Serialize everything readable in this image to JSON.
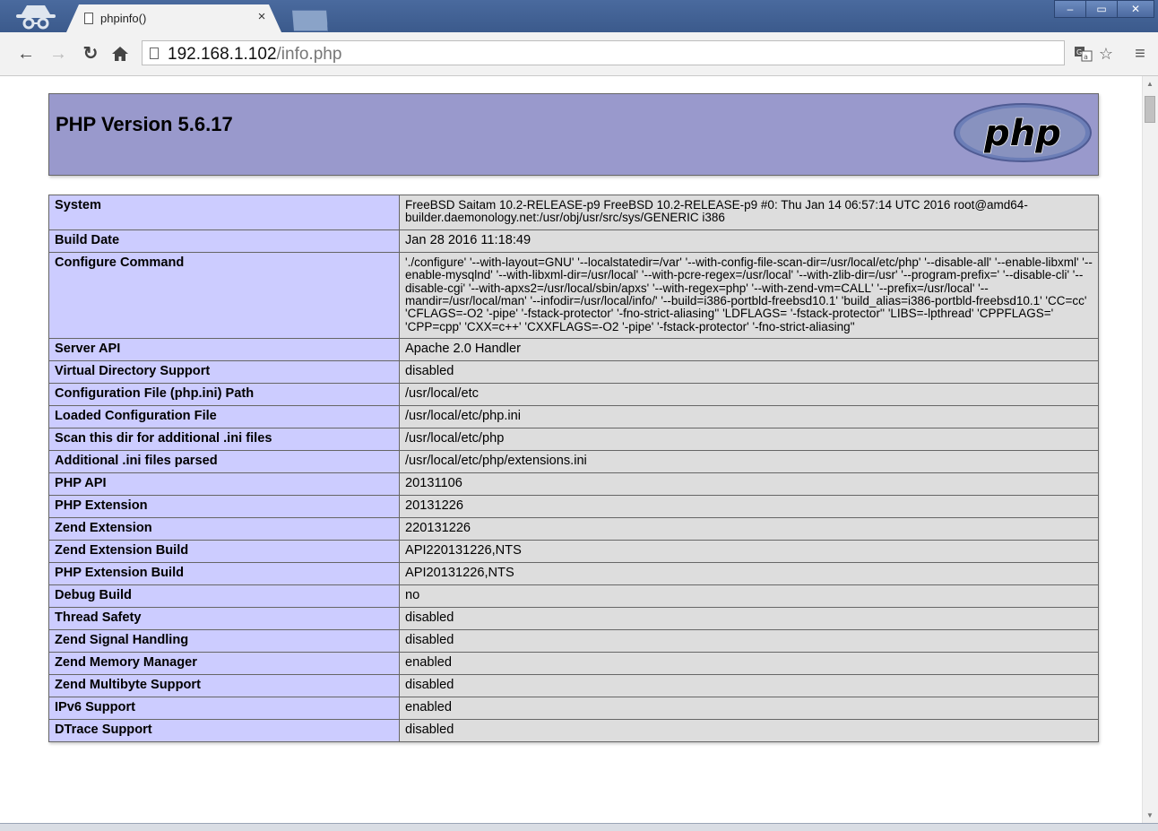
{
  "browser": {
    "tab_title": "phpinfo()",
    "tab_close": "×",
    "url_host": "192.168.1.102",
    "url_path": "/info.php",
    "window_controls": [
      "–",
      "▭",
      "✕"
    ]
  },
  "page": {
    "version_title": "PHP Version 5.6.17",
    "logo_text": "php",
    "rows": [
      {
        "key": "System",
        "value": "FreeBSD Saitam 10.2-RELEASE-p9 FreeBSD 10.2-RELEASE-p9 #0: Thu Jan 14 06:57:14 UTC 2016 root@amd64-builder.daemonology.net:/usr/obj/usr/src/sys/GENERIC i386"
      },
      {
        "key": "Build Date",
        "value": "Jan 28 2016 11:18:49"
      },
      {
        "key": "Configure Command",
        "value": "'./configure' '--with-layout=GNU' '--localstatedir=/var' '--with-config-file-scan-dir=/usr/local/etc/php' '--disable-all' '--enable-libxml' '--enable-mysqlnd' '--with-libxml-dir=/usr/local' '--with-pcre-regex=/usr/local' '--with-zlib-dir=/usr' '--program-prefix=' '--disable-cli' '--disable-cgi' '--with-apxs2=/usr/local/sbin/apxs' '--with-regex=php' '--with-zend-vm=CALL' '--prefix=/usr/local' '--mandir=/usr/local/man' '--infodir=/usr/local/info/' '--build=i386-portbld-freebsd10.1' 'build_alias=i386-portbld-freebsd10.1' 'CC=cc' 'CFLAGS=-O2 '-pipe' '-fstack-protector' '-fno-strict-aliasing'' 'LDFLAGS= '-fstack-protector'' 'LIBS=-lpthread' 'CPPFLAGS=' 'CPP=cpp' 'CXX=c++' 'CXXFLAGS=-O2 '-pipe' '-fstack-protector' '-fno-strict-aliasing''"
      },
      {
        "key": "Server API",
        "value": "Apache 2.0 Handler"
      },
      {
        "key": "Virtual Directory Support",
        "value": "disabled"
      },
      {
        "key": "Configuration File (php.ini) Path",
        "value": "/usr/local/etc"
      },
      {
        "key": "Loaded Configuration File",
        "value": "/usr/local/etc/php.ini"
      },
      {
        "key": "Scan this dir for additional .ini files",
        "value": "/usr/local/etc/php"
      },
      {
        "key": "Additional .ini files parsed",
        "value": "/usr/local/etc/php/extensions.ini"
      },
      {
        "key": "PHP API",
        "value": "20131106"
      },
      {
        "key": "PHP Extension",
        "value": "20131226"
      },
      {
        "key": "Zend Extension",
        "value": "220131226"
      },
      {
        "key": "Zend Extension Build",
        "value": "API220131226,NTS"
      },
      {
        "key": "PHP Extension Build",
        "value": "API20131226,NTS"
      },
      {
        "key": "Debug Build",
        "value": "no"
      },
      {
        "key": "Thread Safety",
        "value": "disabled"
      },
      {
        "key": "Zend Signal Handling",
        "value": "disabled"
      },
      {
        "key": "Zend Memory Manager",
        "value": "enabled"
      },
      {
        "key": "Zend Multibyte Support",
        "value": "disabled"
      },
      {
        "key": "IPv6 Support",
        "value": "enabled"
      },
      {
        "key": "DTrace Support",
        "value": "disabled"
      }
    ]
  },
  "colors": {
    "header_bg": "#9999cc",
    "key_bg": "#ccccff",
    "value_bg": "#dddddd",
    "chrome_frame": "#3b5a8c"
  }
}
